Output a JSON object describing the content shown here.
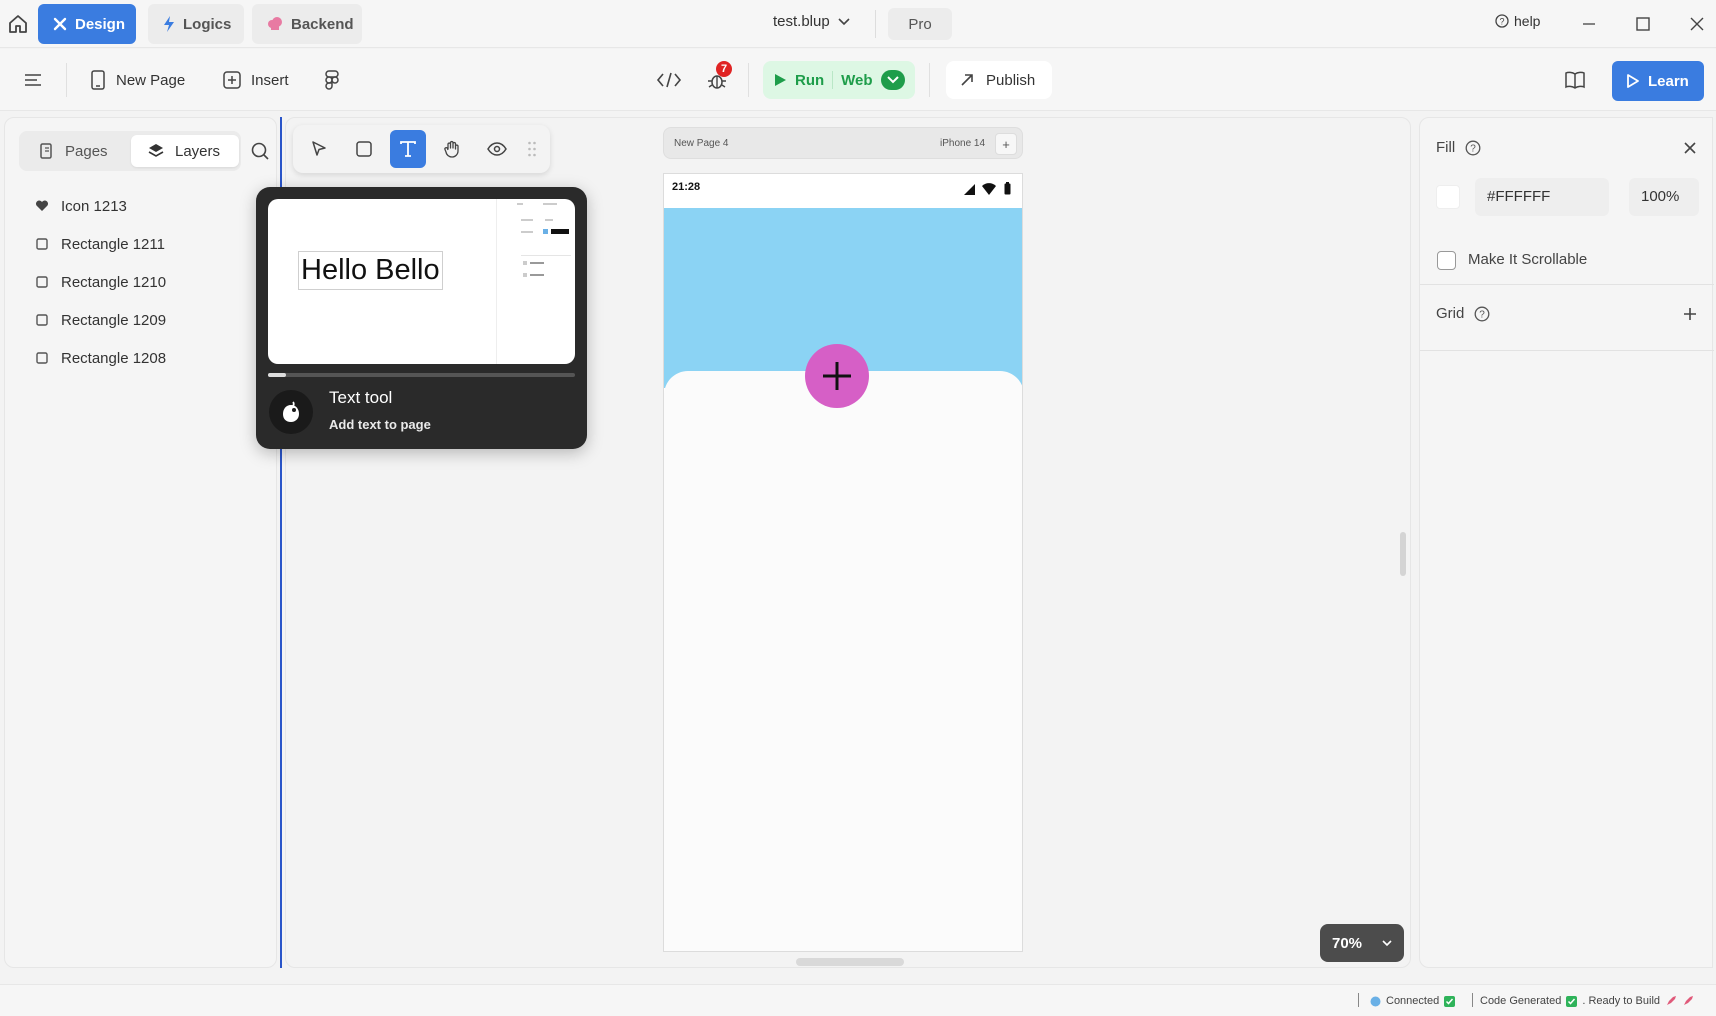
{
  "titlebar": {
    "tabs": [
      {
        "label": "Design"
      },
      {
        "label": "Logics"
      },
      {
        "label": "Backend"
      }
    ],
    "filename": "test.blup",
    "plan": "Pro",
    "help": "help"
  },
  "toolbar": {
    "new_page": "New Page",
    "insert": "Insert",
    "bug_count": "7",
    "run": "Run",
    "platform": "Web",
    "publish": "Publish",
    "learn": "Learn"
  },
  "left_panel": {
    "tabs": {
      "pages": "Pages",
      "layers": "Layers"
    },
    "layers": [
      {
        "label": "Icon 1213",
        "icon": "heart-icon"
      },
      {
        "label": "Rectangle 1211",
        "icon": "rectangle-icon"
      },
      {
        "label": "Rectangle 1210",
        "icon": "rectangle-icon"
      },
      {
        "label": "Rectangle 1209",
        "icon": "rectangle-icon"
      },
      {
        "label": "Rectangle 1208",
        "icon": "rectangle-icon"
      }
    ]
  },
  "canvas": {
    "page_name": "New Page 4",
    "device": "iPhone 14",
    "status_time": "21:28",
    "zoom": "70%",
    "colors": {
      "header": "#8bd3f4",
      "fab": "#d65fc6",
      "accent": "#3a7ce0"
    }
  },
  "tooltip": {
    "preview_text": "Hello Bello",
    "title": "Text tool",
    "subtitle": "Add text to page"
  },
  "right_panel": {
    "fill_label": "Fill",
    "fill_hex": "#FFFFFF",
    "fill_opacity": "100%",
    "scrollable_label": "Make It Scrollable",
    "grid_label": "Grid"
  },
  "statusbar": {
    "connected": "Connected",
    "code": "Code Generated",
    "ready": ". Ready to Build"
  }
}
